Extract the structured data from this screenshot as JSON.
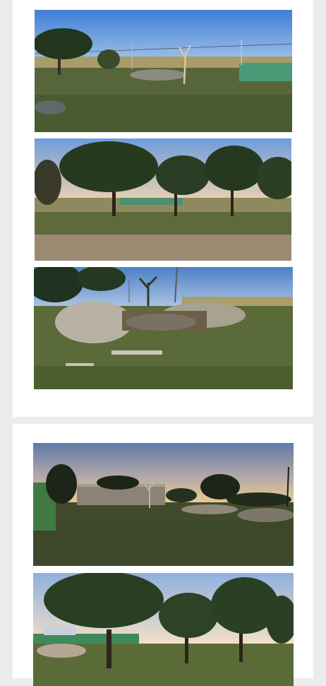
{
  "feed": {
    "cards": [
      {
        "photos": [
          {
            "subject": "vacant-lot-with-trees-and-fence",
            "sky": "#5b8fd4"
          },
          {
            "subject": "roadside-lot-with-trees",
            "sky": "#8fb2e0"
          },
          {
            "subject": "excavated-lot-with-mounds",
            "sky": "#6e95c8"
          }
        ]
      },
      {
        "photos": [
          {
            "subject": "lot-at-dusk-with-building",
            "sky": "#8d8aa0"
          },
          {
            "subject": "lot-with-large-trees",
            "sky": "#b7cce4"
          }
        ]
      }
    ]
  },
  "colors": {
    "background": "#ececec",
    "card": "#ffffff",
    "grass": "#5a6b3a",
    "dirt": "#9b8a72"
  }
}
